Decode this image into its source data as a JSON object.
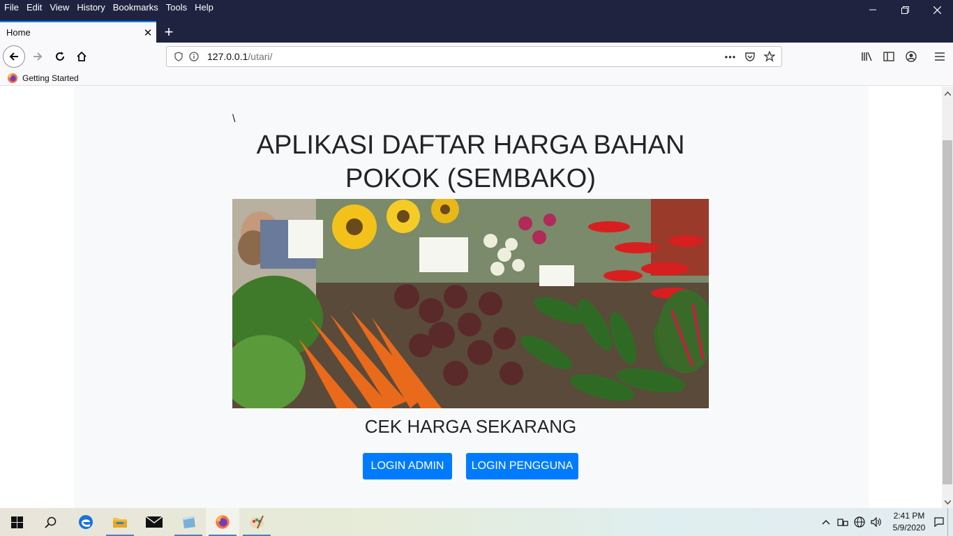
{
  "menu": [
    "File",
    "Edit",
    "View",
    "History",
    "Bookmarks",
    "Tools",
    "Help"
  ],
  "window_controls": {
    "minimize": "—",
    "restore": "❐",
    "close": "✕"
  },
  "tab": {
    "title": "Home",
    "close": "✕",
    "new_tab": "+"
  },
  "url": {
    "host": "127.0.0.1",
    "path": "/utari/",
    "more": "•••"
  },
  "bookmarks": [
    {
      "label": "Getting Started"
    }
  ],
  "page": {
    "backslash": "\\",
    "title_line1": "APLIKASI DAFTAR HARGA BAHAN",
    "title_line2": "POKOK (SEMBAKO)",
    "subheading": "CEK HARGA SEKARANG",
    "btn_admin": "LOGIN ADMIN",
    "btn_user": "LOGIN PENGGUNA"
  },
  "taskbar": {
    "clock_time": "2:41 PM",
    "clock_date": "5/9/2020"
  },
  "colors": {
    "titlebar": "#202340",
    "primary_button": "#007bff",
    "page_bg": "#f8f9fa"
  }
}
